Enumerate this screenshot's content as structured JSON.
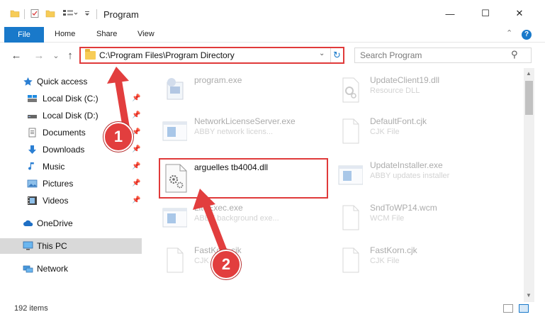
{
  "window": {
    "title": "Program",
    "minimize": "—",
    "maximize": "☐",
    "close": "✕"
  },
  "ribbon": {
    "file": "File",
    "home": "Home",
    "share": "Share",
    "view": "View",
    "help": "?",
    "collapse": "⌃"
  },
  "nav": {
    "back": "←",
    "forward": "→",
    "recent": "⌄",
    "up": "↑"
  },
  "address": {
    "path": "C:\\Program Files\\Program Directory",
    "dropdown": "⌄",
    "refresh": "↻"
  },
  "search": {
    "placeholder": "Search Program",
    "icon": "⚲"
  },
  "sidebar": {
    "items": [
      {
        "label": "Quick access",
        "icon": "star-icon",
        "pinned": false
      },
      {
        "label": "Local Disk (C:)",
        "icon": "drive-icon",
        "pinned": true
      },
      {
        "label": "Local Disk (D:)",
        "icon": "drive-icon",
        "pinned": true
      },
      {
        "label": "Documents",
        "icon": "documents-icon",
        "pinned": true
      },
      {
        "label": "Downloads",
        "icon": "download-icon",
        "pinned": true
      },
      {
        "label": "Music",
        "icon": "music-icon",
        "pinned": true
      },
      {
        "label": "Pictures",
        "icon": "pictures-icon",
        "pinned": true
      },
      {
        "label": "Videos",
        "icon": "videos-icon",
        "pinned": true
      },
      {
        "label": "OneDrive",
        "icon": "cloud-icon",
        "pinned": false
      },
      {
        "label": "This PC",
        "icon": "monitor-icon",
        "pinned": false
      },
      {
        "label": "Network",
        "icon": "network-icon",
        "pinned": false
      }
    ],
    "pin_glyph": "📌"
  },
  "files": {
    "left": [
      {
        "name": "program.exe",
        "desc": ""
      },
      {
        "name": "NetworkLicenseServer.exe",
        "desc": "ABBY network licens..."
      },
      {
        "name": "LiteExec.exe",
        "desc": "ABBY background exe..."
      },
      {
        "name": "FastKorn.cjk",
        "desc": "CJK File"
      }
    ],
    "right": [
      {
        "name": "UpdateClient19.dll",
        "desc": "Resource DLL"
      },
      {
        "name": "DefaultFont.cjk",
        "desc": "CJK File"
      },
      {
        "name": "UpdateInstaller.exe",
        "desc": "ABBY updates installer"
      },
      {
        "name": "SndToWP14.wcm",
        "desc": "WCM File"
      },
      {
        "name": "FastKorn.cjk",
        "desc": "CJK File"
      }
    ],
    "highlighted": {
      "name": "arguelles tb4004.dll"
    }
  },
  "status": {
    "count": "192 items"
  },
  "annotations": {
    "step1": "1",
    "step2": "2",
    "color": "#e23e3e"
  }
}
